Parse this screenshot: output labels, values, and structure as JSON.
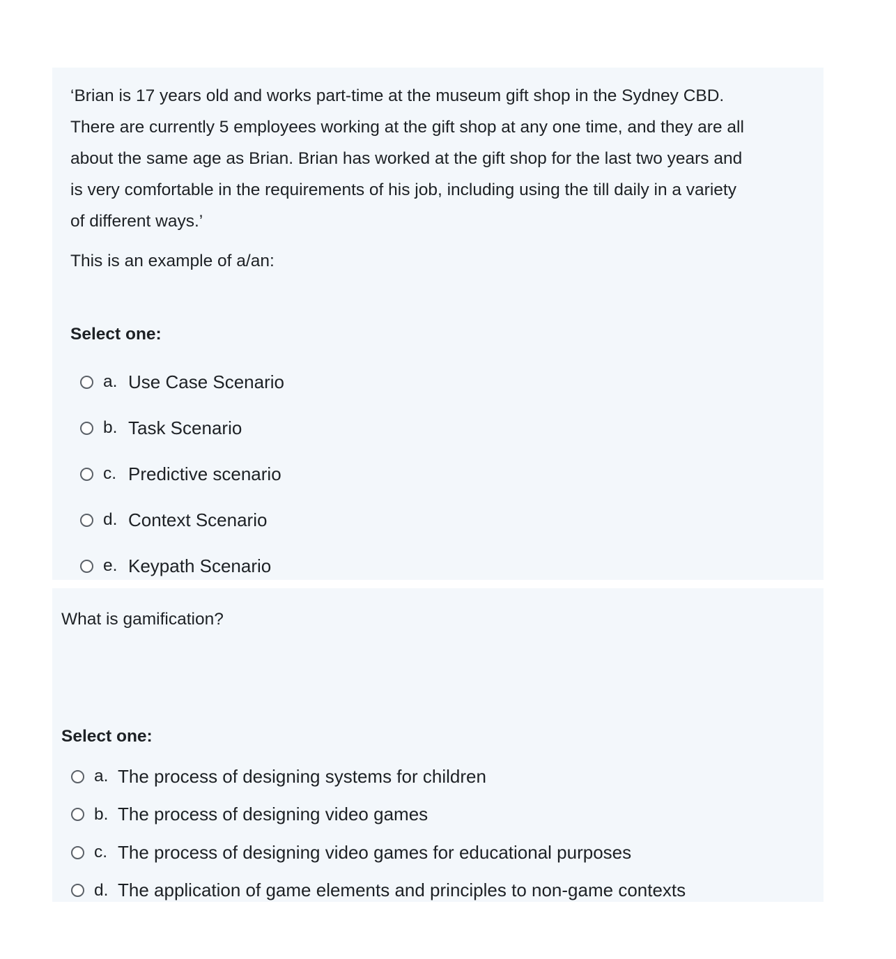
{
  "questions": [
    {
      "text_lines": [
        "‘Brian is 17 years old and works part-time at the museum gift shop in the Sydney CBD.",
        "There are currently 5 employees working at the gift shop at any one time, and they are all",
        "about the same age as Brian. Brian has worked at the gift shop for the last two years and",
        "is very comfortable in the requirements of his job, including using the till daily in a variety",
        "of different ways.’"
      ],
      "prompt": "This is an example of a/an:",
      "select_label": "Select one:",
      "options": [
        {
          "letter": "a.",
          "text": "Use Case Scenario"
        },
        {
          "letter": "b.",
          "text": "Task Scenario"
        },
        {
          "letter": "c.",
          "text": "Predictive scenario"
        },
        {
          "letter": "d.",
          "text": "Context Scenario"
        },
        {
          "letter": "e.",
          "text": "Keypath Scenario"
        }
      ]
    },
    {
      "prompt": "What is gamification?",
      "select_label": "Select one:",
      "options": [
        {
          "letter": "a.",
          "text": "The process of designing systems for children"
        },
        {
          "letter": "b.",
          "text": "The process of designing video games"
        },
        {
          "letter": "c.",
          "text": "The process of designing video games for educational purposes"
        },
        {
          "letter": "d.",
          "text": "The application of game elements and principles to non-game contexts"
        }
      ]
    }
  ]
}
